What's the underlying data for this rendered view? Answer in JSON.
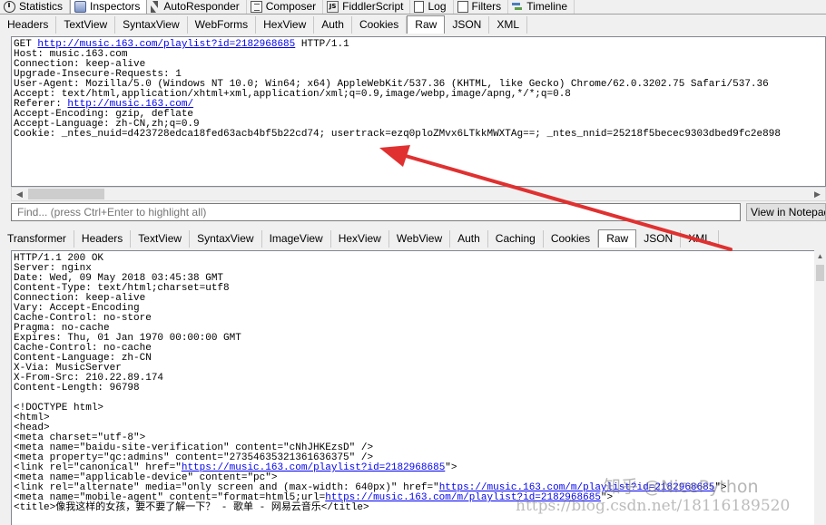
{
  "main_tabs": [
    {
      "label": "Statistics",
      "icon": "stopwatch-icon"
    },
    {
      "label": "Inspectors",
      "icon": "inspector-icon",
      "active": true
    },
    {
      "label": "AutoResponder",
      "icon": "lightning-icon"
    },
    {
      "label": "Composer",
      "icon": "composer-icon"
    },
    {
      "label": "FiddlerScript",
      "icon": "js-script-icon"
    },
    {
      "label": "Log",
      "icon": "log-icon"
    },
    {
      "label": "Filters",
      "icon": "filter-icon"
    },
    {
      "label": "Timeline",
      "icon": "timeline-icon"
    }
  ],
  "request_tabs": [
    {
      "label": "Headers"
    },
    {
      "label": "TextView"
    },
    {
      "label": "SyntaxView"
    },
    {
      "label": "WebForms"
    },
    {
      "label": "HexView"
    },
    {
      "label": "Auth"
    },
    {
      "label": "Cookies"
    },
    {
      "label": "Raw",
      "active": true
    },
    {
      "label": "JSON"
    },
    {
      "label": "XML"
    }
  ],
  "request_lines": [
    [
      {
        "t": "GET "
      },
      {
        "t": "http://music.163.com/playlist?id=2182968685",
        "link": true
      },
      {
        "t": " HTTP/1.1"
      }
    ],
    [
      {
        "t": "Host: music.163.com"
      }
    ],
    [
      {
        "t": "Connection: keep-alive"
      }
    ],
    [
      {
        "t": "Upgrade-Insecure-Requests: 1"
      }
    ],
    [
      {
        "t": "User-Agent: Mozilla/5.0 (Windows NT 10.0; Win64; x64) AppleWebKit/537.36 (KHTML, like Gecko) Chrome/62.0.3202.75 Safari/537.36"
      }
    ],
    [
      {
        "t": "Accept: text/html,application/xhtml+xml,application/xml;q=0.9,image/webp,image/apng,*/*;q=0.8"
      }
    ],
    [
      {
        "t": "Referer: "
      },
      {
        "t": "http://music.163.com/",
        "link": true
      }
    ],
    [
      {
        "t": "Accept-Encoding: gzip, deflate"
      }
    ],
    [
      {
        "t": "Accept-Language: zh-CN,zh;q=0.9"
      }
    ],
    [
      {
        "t": "Cookie: _ntes_nuid=d423728edca18fed63acb4bf5b22cd74; usertrack=ezq0ploZMvx6LTkkMWXTAg==; _ntes_nnid=25218f5becec9303dbed9fc2e898"
      }
    ]
  ],
  "find": {
    "placeholder": "Find... (press Ctrl+Enter to highlight all)",
    "value": ""
  },
  "view_in_notepad_label": "View in Notepad",
  "response_tabs": [
    {
      "label": "Transformer"
    },
    {
      "label": "Headers"
    },
    {
      "label": "TextView"
    },
    {
      "label": "SyntaxView"
    },
    {
      "label": "ImageView"
    },
    {
      "label": "HexView"
    },
    {
      "label": "WebView"
    },
    {
      "label": "Auth"
    },
    {
      "label": "Caching"
    },
    {
      "label": "Cookies"
    },
    {
      "label": "Raw",
      "active": true
    },
    {
      "label": "JSON"
    },
    {
      "label": "XML"
    }
  ],
  "response_lines": [
    [
      {
        "t": "HTTP/1.1 200 OK"
      }
    ],
    [
      {
        "t": "Server: nginx"
      }
    ],
    [
      {
        "t": "Date: Wed, 09 May 2018 03:45:38 GMT"
      }
    ],
    [
      {
        "t": "Content-Type: text/html;charset=utf8"
      }
    ],
    [
      {
        "t": "Connection: keep-alive"
      }
    ],
    [
      {
        "t": "Vary: Accept-Encoding"
      }
    ],
    [
      {
        "t": "Cache-Control: no-store"
      }
    ],
    [
      {
        "t": "Pragma: no-cache"
      }
    ],
    [
      {
        "t": "Expires: Thu, 01 Jan 1970 00:00:00 GMT"
      }
    ],
    [
      {
        "t": "Cache-Control: no-cache"
      }
    ],
    [
      {
        "t": "Content-Language: zh-CN"
      }
    ],
    [
      {
        "t": "X-Via: MusicServer"
      }
    ],
    [
      {
        "t": "X-From-Src: 210.22.89.174"
      }
    ],
    [
      {
        "t": "Content-Length: 96798"
      }
    ],
    [
      {
        "t": ""
      }
    ],
    [
      {
        "t": "<!DOCTYPE html>"
      }
    ],
    [
      {
        "t": "<html>"
      }
    ],
    [
      {
        "t": "<head>"
      }
    ],
    [
      {
        "t": "<meta charset=\"utf-8\">"
      }
    ],
    [
      {
        "t": "<meta name=\"baidu-site-verification\" content=\"cNhJHKEzsD\" />"
      }
    ],
    [
      {
        "t": "<meta property=\"qc:admins\" content=\"27354635321361636375\" />"
      }
    ],
    [
      {
        "t": "<link rel=\"canonical\" href=\""
      },
      {
        "t": "https://music.163.com/playlist?id=2182968685",
        "link": true
      },
      {
        "t": "\">"
      }
    ],
    [
      {
        "t": "<meta name=\"applicable-device\" content=\"pc\">"
      }
    ],
    [
      {
        "t": "<link rel=\"alternate\" media=\"only screen and (max-width: 640px)\" href=\""
      },
      {
        "t": "https://music.163.com/m/playlist?id=2182968685",
        "link": true
      },
      {
        "t": "\">"
      }
    ],
    [
      {
        "t": "<meta name=\"mobile-agent\" content=\"format=html5;url="
      },
      {
        "t": "https://music.163.com/m/playlist?id=2182968685",
        "link": true
      },
      {
        "t": "\">"
      }
    ],
    [
      {
        "t": "<title>像我这样的女孩，要不要了解一下？ - 歌单 - 网易云音乐</title>"
      }
    ]
  ],
  "watermark": {
    "line1": "知乎 @NicePython",
    "line2": "https://blog.csdn.net/18116189520"
  },
  "colors": {
    "link": "#0000ee",
    "annotation_arrow": "#e03030"
  }
}
